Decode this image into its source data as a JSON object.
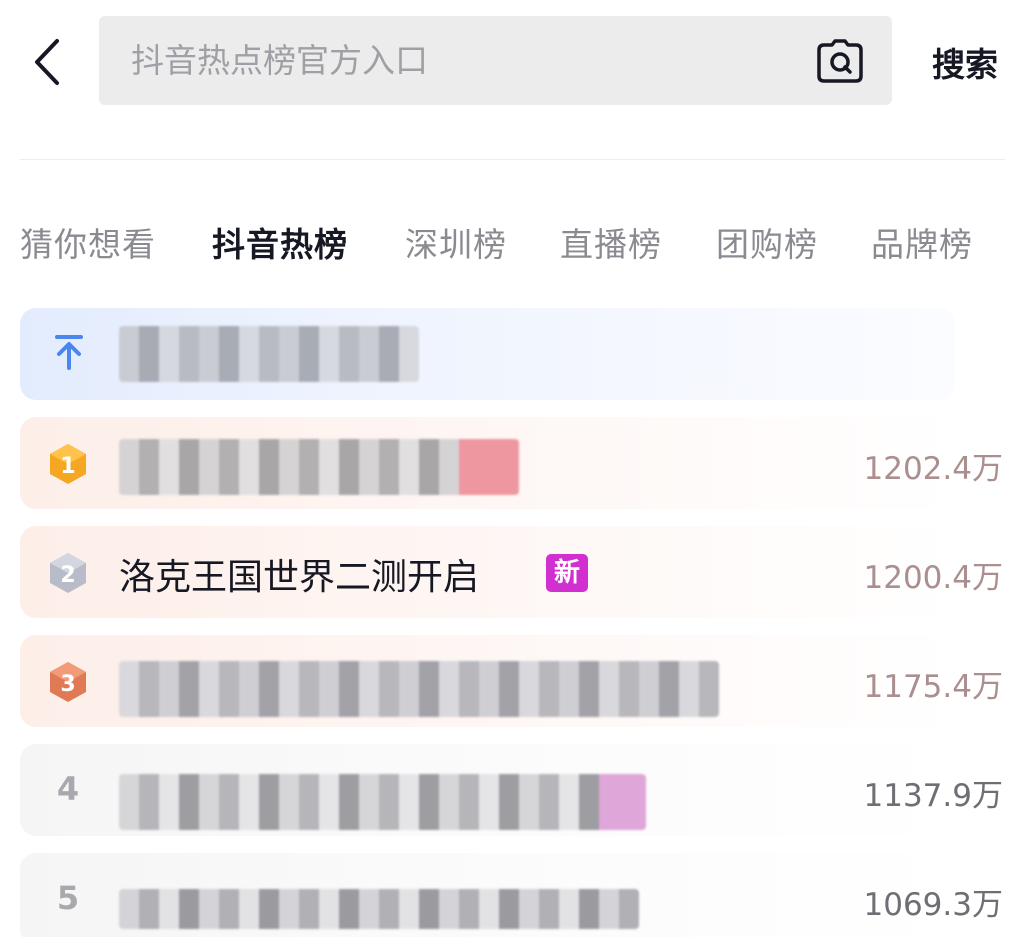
{
  "search": {
    "placeholder": "抖音热点榜官方入口",
    "button_label": "搜索"
  },
  "tabs": [
    {
      "label": "猜你想看",
      "active": false
    },
    {
      "label": "抖音热榜",
      "active": true
    },
    {
      "label": "深圳榜",
      "active": false
    },
    {
      "label": "直播榜",
      "active": false
    },
    {
      "label": "团购榜",
      "active": false
    },
    {
      "label": "品牌榜",
      "active": false
    }
  ],
  "hot_list": {
    "pinned": {
      "icon": "pin-top-icon",
      "title_obscured": true
    },
    "items": [
      {
        "rank": "1",
        "title": "",
        "title_obscured": true,
        "value": "1202.4万",
        "badge_color": "#f5a623"
      },
      {
        "rank": "2",
        "title": "洛克王国世界二测开启",
        "title_obscured": false,
        "badge": "新",
        "value": "1200.4万",
        "badge_color": "#b8bcc8"
      },
      {
        "rank": "3",
        "title": "",
        "title_obscured": true,
        "value": "1175.4万",
        "badge_color": "#e07a55"
      },
      {
        "rank": "4",
        "title": "",
        "title_obscured": true,
        "value": "1137.9万"
      },
      {
        "rank": "5",
        "title": "",
        "title_obscured": true,
        "value": "1069.3万"
      }
    ]
  },
  "colors": {
    "new_badge": "#d12fcf",
    "pinned_icon": "#4a86f0",
    "top_value": "#ab8f8f"
  }
}
